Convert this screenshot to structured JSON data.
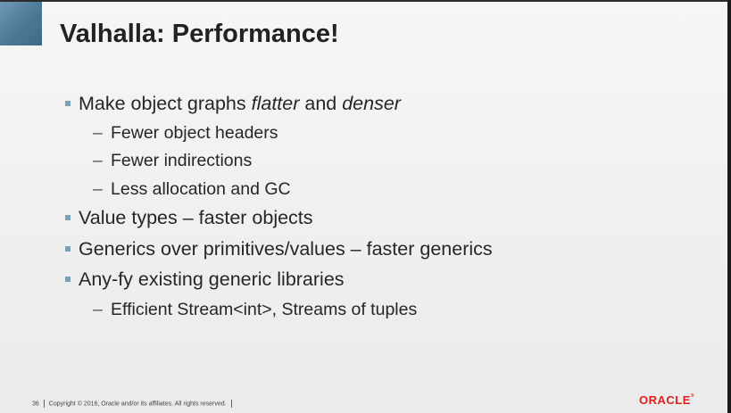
{
  "slide": {
    "title": "Valhalla: Performance!",
    "items": [
      {
        "parts": [
          "Make object graphs ",
          "flatter",
          " and ",
          "denser"
        ],
        "sub": [
          "Fewer object headers",
          "Fewer indirections",
          "Less allocation and GC"
        ]
      },
      {
        "text": "Value types – faster objects"
      },
      {
        "text": "Generics over primitives/values – faster generics"
      },
      {
        "text": "Any-fy existing generic libraries",
        "sub": [
          "Efficient Stream<int>, Streams of tuples"
        ]
      }
    ],
    "dash": "–"
  },
  "footer": {
    "page_number": "36",
    "copyright": "Copyright © 2016, Oracle and/or its affiliates. All rights reserved."
  },
  "logo": {
    "text": "ORACLE",
    "mark": "®"
  },
  "colors": {
    "corner": "#4c7896",
    "bullet": "#7b9fb7",
    "logo": "#e01f1f"
  }
}
